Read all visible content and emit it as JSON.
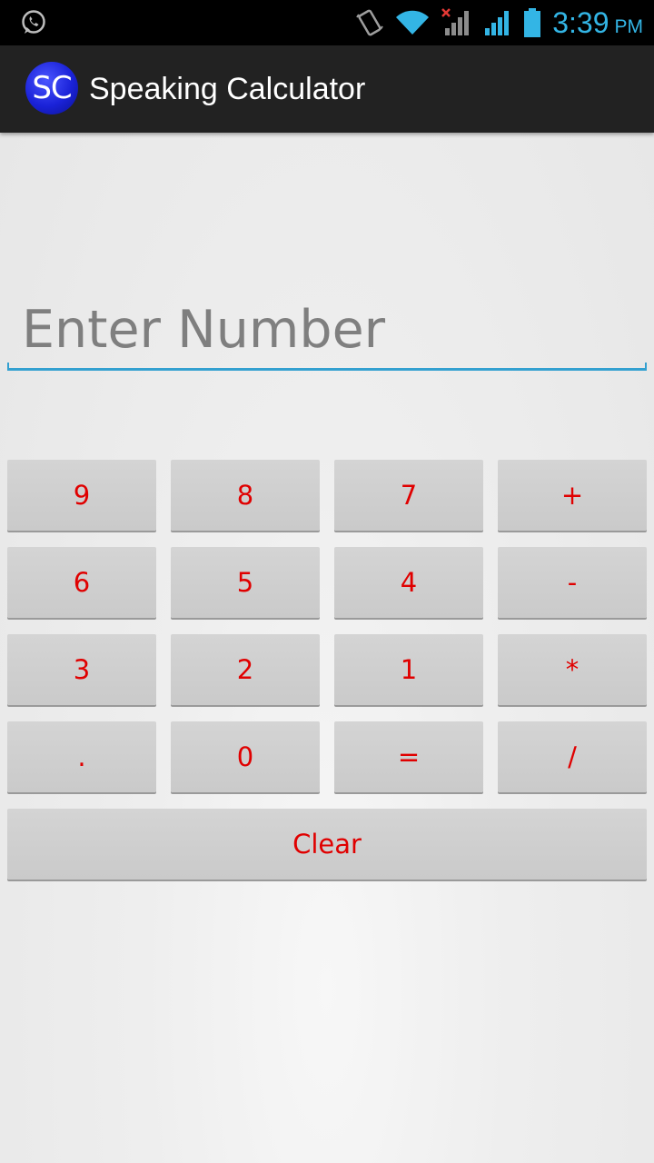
{
  "status_bar": {
    "time": "3:39",
    "ampm": "PM",
    "time_color": "#33b5e5",
    "icons": [
      "whatsapp-icon",
      "vibrate-icon",
      "wifi-icon",
      "signal-no-sim-icon",
      "signal-icon",
      "battery-icon"
    ]
  },
  "action_bar": {
    "logo_text": "SC",
    "title": "Speaking Calculator"
  },
  "input": {
    "placeholder": "Enter Number",
    "value": "",
    "underline_color": "#33a0d0"
  },
  "keypad": {
    "keys": [
      "9",
      "8",
      "7",
      "+",
      "6",
      "5",
      "4",
      "-",
      "3",
      "2",
      "1",
      "*",
      ".",
      "0",
      "=",
      "/"
    ],
    "clear_label": "Clear",
    "text_color": "#e00000"
  }
}
